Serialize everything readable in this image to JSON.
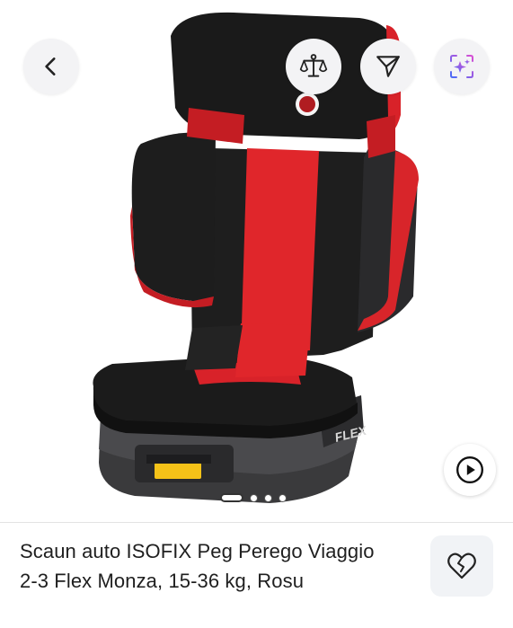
{
  "gallery": {
    "image_alt": "Scaun auto ISOFIX Peg Perego Viaggio 2-3 Flex Monza",
    "seat_logo_text": "FLEX",
    "slide_count": 4,
    "active_slide": 1
  },
  "toolbar": {
    "back_icon": "chevron-left-icon",
    "compare_icon": "balance-scale-icon",
    "share_icon": "send-icon",
    "ai_icon": "ai-sparkle-icon"
  },
  "video": {
    "icon": "play-icon"
  },
  "product": {
    "title": "Scaun auto ISOFIX Peg Perego Viaggio 2-3 Flex Monza, 15-36 kg, Rosu"
  },
  "favorite": {
    "icon": "heart-icon"
  },
  "colors": {
    "seat_red": "#e0262b",
    "seat_black": "#1b1b1b",
    "ai_gradient_start": "#4a6cf7",
    "ai_gradient_end": "#d94fd3"
  }
}
